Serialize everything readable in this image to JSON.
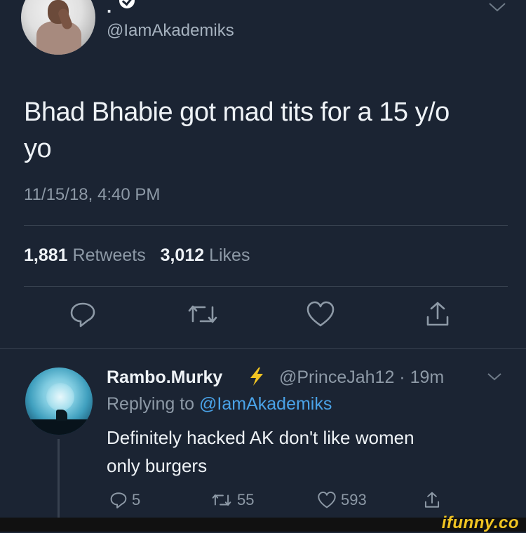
{
  "tweet": {
    "author_name": ".",
    "handle": "@IamAkademiks",
    "text_line1": "Bhad Bhabie got mad tits for a 15 y/o",
    "text_line2": "yo",
    "timestamp": "11/15/18, 4:40 PM",
    "retweets_count": "1,881",
    "retweets_label": "Retweets",
    "likes_count": "3,012",
    "likes_label": "Likes"
  },
  "actions": [
    {
      "icon": "reply-icon"
    },
    {
      "icon": "retweet-icon"
    },
    {
      "icon": "like-icon"
    },
    {
      "icon": "share-icon"
    }
  ],
  "reply": {
    "name": "Rambo.Murky",
    "badge_icon": "lightning-bolt-icon",
    "handle_time": "@PrinceJah12 · 19m",
    "replying_prefix": "Replying to",
    "replying_mention": "@IamAkademiks",
    "text_line1": "Definitely hacked AK don't like women",
    "text_line2": "only burgers",
    "reply_count": "5",
    "retweet_count": "55",
    "like_count": "593"
  },
  "watermark": "ifunny.co",
  "colors": {
    "background": "#1b2433",
    "link": "#4aa3e8",
    "muted": "#8d99a6",
    "bolt": "#f2c522",
    "watermark": "#f2c522"
  }
}
